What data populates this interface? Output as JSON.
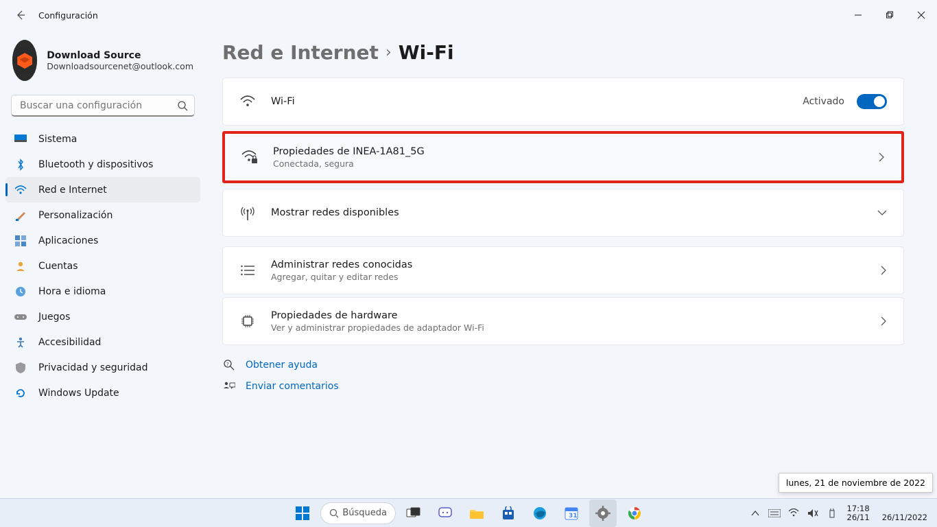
{
  "window": {
    "title": "Configuración"
  },
  "profile": {
    "name": "Download Source",
    "email": "Downloadsourcenet@outlook.com"
  },
  "search": {
    "placeholder": "Buscar una configuración"
  },
  "sidebar": {
    "items": [
      {
        "label": "Sistema"
      },
      {
        "label": "Bluetooth y dispositivos"
      },
      {
        "label": "Red e Internet"
      },
      {
        "label": "Personalización"
      },
      {
        "label": "Aplicaciones"
      },
      {
        "label": "Cuentas"
      },
      {
        "label": "Hora e idioma"
      },
      {
        "label": "Juegos"
      },
      {
        "label": "Accesibilidad"
      },
      {
        "label": "Privacidad y seguridad"
      },
      {
        "label": "Windows Update"
      }
    ]
  },
  "breadcrumb": {
    "parent": "Red e Internet",
    "current": "Wi-Fi"
  },
  "rows": {
    "wifi": {
      "title": "Wi-Fi",
      "state": "Activado"
    },
    "props": {
      "title": "Propiedades de INEA-1A81_5G",
      "sub": "Conectada, segura"
    },
    "show": {
      "title": "Mostrar redes disponibles"
    },
    "known": {
      "title": "Administrar redes conocidas",
      "sub": "Agregar, quitar y editar redes"
    },
    "hw": {
      "title": "Propiedades de hardware",
      "sub": "Ver y administrar propiedades de adaptador Wi-Fi"
    }
  },
  "help": {
    "get": "Obtener ayuda",
    "feedback": "Enviar comentarios"
  },
  "tooltip": "lunes, 21 de noviembre de 2022",
  "taskbar": {
    "search": "Búsqueda",
    "time": "17:18",
    "date1": "26/11",
    "date2": "26/11/2022"
  }
}
